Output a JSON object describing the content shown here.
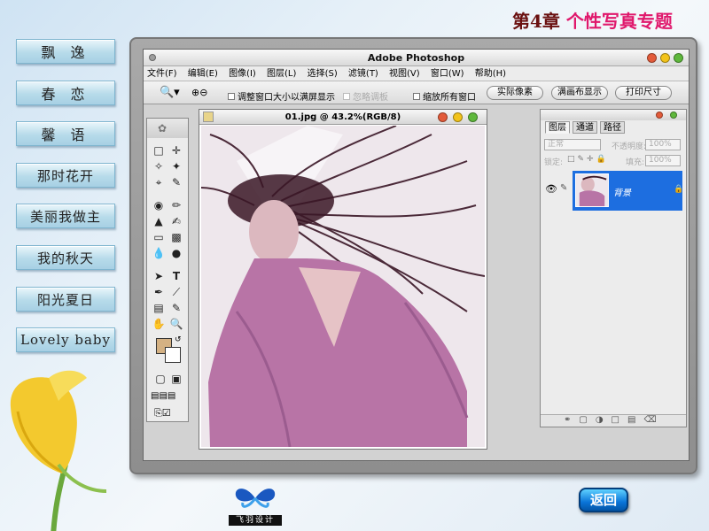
{
  "header": {
    "chapter_prefix": "第4章",
    "chapter_title": "个性写真专题"
  },
  "nav": {
    "items": [
      {
        "label": "飘 逸"
      },
      {
        "label": "春 恋"
      },
      {
        "label": "馨 语"
      },
      {
        "label": "那时花开"
      },
      {
        "label": "美丽我做主"
      },
      {
        "label": "我的秋天"
      },
      {
        "label": "阳光夏日"
      },
      {
        "label": "Lovely baby"
      }
    ]
  },
  "photoshop": {
    "app_title": "Adobe Photoshop",
    "menu": [
      "文件(F)",
      "编辑(E)",
      "图像(I)",
      "图层(L)",
      "选择(S)",
      "滤镜(T)",
      "视图(V)",
      "窗口(W)",
      "帮助(H)"
    ],
    "options": {
      "resize_label": "调整窗口大小以满屏显示",
      "ignore_palettes_label": "忽略调板",
      "zoom_all_label": "缩放所有窗口",
      "actual_pixels": "实际像素",
      "fit_screen": "满画布显示",
      "print_size": "打印尺寸"
    },
    "document": {
      "title": "01.jpg @ 43.2%(RGB/8)"
    },
    "layers_panel": {
      "tabs": [
        "图层",
        "通道",
        "路径"
      ],
      "blend_mode": "正常",
      "opacity_label": "不透明度:",
      "opacity_value": "100%",
      "lock_label": "锁定:",
      "fill_label": "填充:",
      "fill_value": "100%",
      "layer_name": "背景"
    }
  },
  "footer": {
    "logo_text": "飞羽设计",
    "return_label": "返回"
  },
  "colors": {
    "accent_pink": "#e0186c",
    "chapter_dark": "#6a1010",
    "layer_selected": "#1d6ee0",
    "foreground_swatch": "#d4b183"
  }
}
